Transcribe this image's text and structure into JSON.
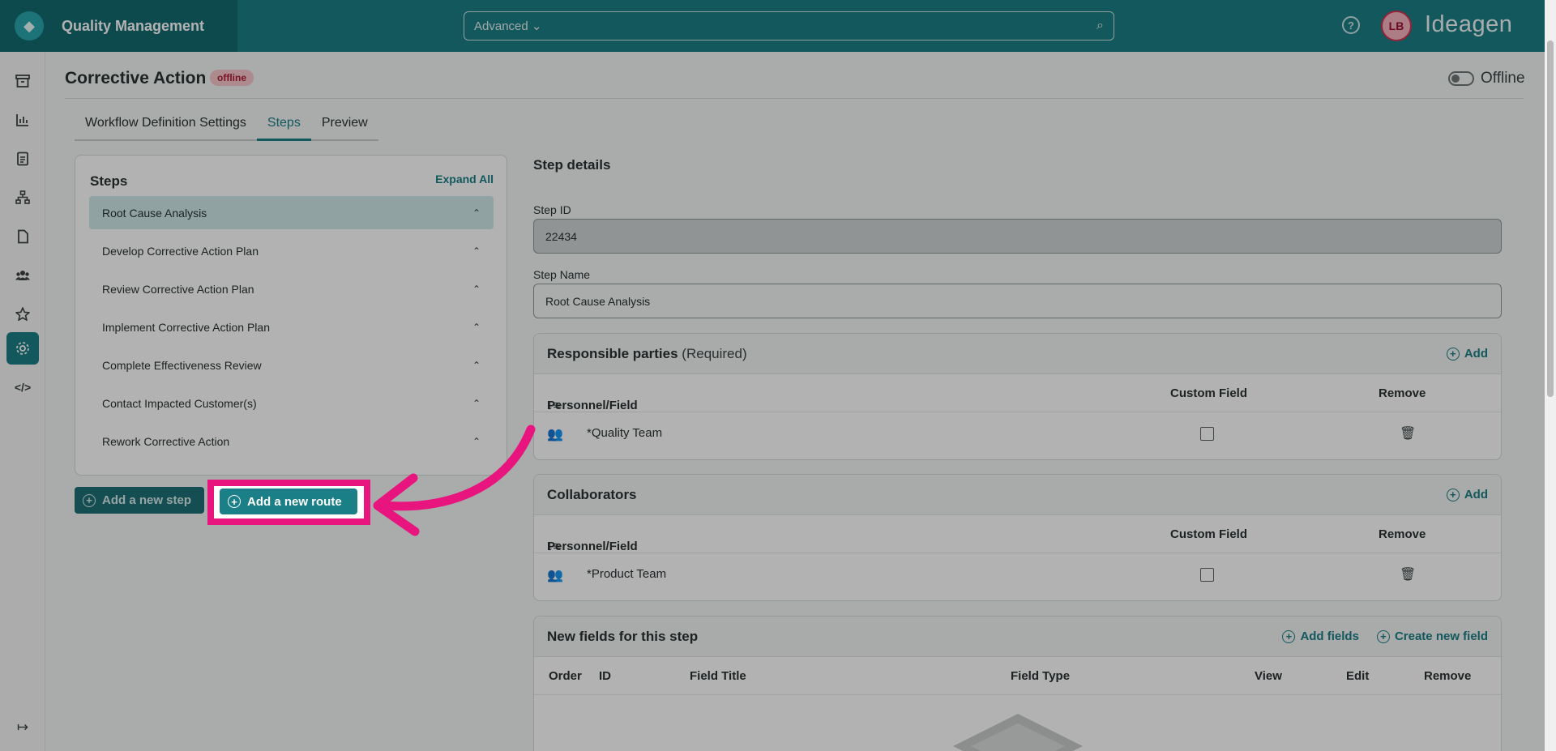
{
  "header": {
    "app_title": "Quality Management",
    "search_mode": "Advanced",
    "help_glyph": "?",
    "user_initials": "LB",
    "vendor": "Ideagen"
  },
  "rail": {
    "items": [
      "archive-icon",
      "chart-icon",
      "document-icon",
      "hierarchy-icon",
      "file-icon",
      "people-icon",
      "star-icon",
      "settings-icon",
      "code-icon"
    ],
    "active": "settings-icon",
    "collapse_icon": "expand-arrow-icon"
  },
  "page": {
    "title": "Corrective Action",
    "status_badge": "offline",
    "toggle_label": "Offline"
  },
  "tabs": [
    {
      "label": "Workflow Definition Settings",
      "active": false
    },
    {
      "label": "Steps",
      "active": true
    },
    {
      "label": "Preview",
      "active": false
    }
  ],
  "steps_panel": {
    "title": "Steps",
    "expand_all": "Expand All",
    "items": [
      {
        "label": "Root Cause Analysis",
        "selected": true
      },
      {
        "label": "Develop Corrective Action Plan",
        "selected": false
      },
      {
        "label": "Review Corrective Action Plan",
        "selected": false
      },
      {
        "label": "Implement Corrective Action Plan",
        "selected": false
      },
      {
        "label": "Complete Effectiveness Review",
        "selected": false
      },
      {
        "label": "Contact Impacted Customer(s)",
        "selected": false
      },
      {
        "label": "Rework Corrective Action",
        "selected": false
      }
    ],
    "add_step": "Add a new step",
    "add_route": "Add a new route"
  },
  "details": {
    "title": "Step details",
    "step_id_label": "Step ID",
    "step_id_value": "22434",
    "step_name_label": "Step Name",
    "step_name_value": "Root Cause Analysis"
  },
  "responsible": {
    "title": "Responsible parties",
    "required": "(Required)",
    "add": "Add",
    "columns": {
      "personnel": "Personnel/Field",
      "custom": "Custom Field",
      "remove": "Remove"
    },
    "rows": [
      {
        "name": "*Quality Team"
      }
    ]
  },
  "collaborators": {
    "title": "Collaborators",
    "add": "Add",
    "columns": {
      "personnel": "Personnel/Field",
      "custom": "Custom Field",
      "remove": "Remove"
    },
    "rows": [
      {
        "name": "*Product Team"
      }
    ]
  },
  "new_fields": {
    "title": "New fields for this step",
    "add_fields": "Add fields",
    "create_field": "Create new field",
    "columns": {
      "order": "Order",
      "id": "ID",
      "field_title": "Field Title",
      "field_type": "Field Type",
      "view": "View",
      "edit": "Edit",
      "remove": "Remove"
    }
  },
  "colors": {
    "brand": "#1a7f86",
    "highlight": "#e8157f",
    "badge_bg": "#f6c6cc",
    "badge_text": "#b01c35"
  }
}
